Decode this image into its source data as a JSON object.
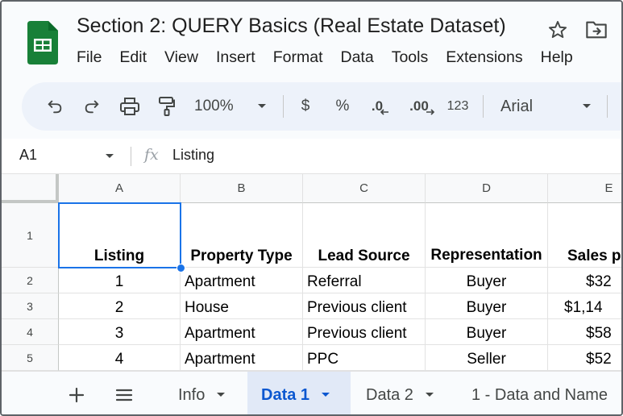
{
  "app": {
    "doc_title": "Section 2: QUERY Basics (Real Estate Dataset)",
    "menu": [
      "File",
      "Edit",
      "View",
      "Insert",
      "Format",
      "Data",
      "Tools",
      "Extensions",
      "Help"
    ]
  },
  "toolbar": {
    "zoom": "100%",
    "currency": "$",
    "percent": "%",
    "decrease_decimal": ".0",
    "increase_decimal": ".00",
    "number_format": "123",
    "font": "Arial"
  },
  "formula_bar": {
    "name_box": "A1",
    "fx": "fx",
    "content": "Listing"
  },
  "grid": {
    "columns": [
      "A",
      "B",
      "C",
      "D",
      "E"
    ],
    "row_numbers": [
      "1",
      "2",
      "3",
      "4",
      "5"
    ],
    "header_row": [
      "Listing",
      "Property Type",
      "Lead Source",
      "Representation",
      "Sales p"
    ],
    "rows": [
      [
        "1",
        "Apartment",
        "Referral",
        "Buyer",
        "$32"
      ],
      [
        "2",
        "House",
        "Previous client",
        "Buyer",
        "$1,14"
      ],
      [
        "3",
        "Apartment",
        "Previous client",
        "Buyer",
        "$58"
      ],
      [
        "4",
        "Apartment",
        "PPC",
        "Seller",
        "$52"
      ]
    ],
    "selected_cell": "A1"
  },
  "sheets": {
    "tabs": [
      "Info",
      "Data 1",
      "Data 2",
      "1 - Data and Name"
    ],
    "active": "Data 1"
  },
  "colors": {
    "accent": "#0b57d0",
    "selection": "#1a73e8",
    "logo_green": "#188038"
  },
  "icons": [
    "sheets-logo-icon",
    "star-icon",
    "move-to-folder-icon",
    "undo-icon",
    "redo-icon",
    "print-icon",
    "paint-format-icon",
    "chevron-down-icon",
    "add-sheet-icon",
    "all-sheets-icon"
  ]
}
